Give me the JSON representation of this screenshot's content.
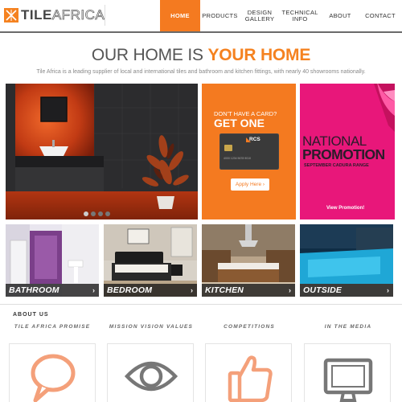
{
  "brand": {
    "name_bold": "TILE",
    "name_thin": "AFRICA",
    "accent": "#f58220"
  },
  "nav": [
    {
      "label": "HOME",
      "active": true
    },
    {
      "label": "PRODUCTS"
    },
    {
      "label": "DESIGN GALLERY"
    },
    {
      "label": "TECHNICAL INFO"
    },
    {
      "label": "ABOUT"
    },
    {
      "label": "CONTACT"
    }
  ],
  "hero": {
    "headline_a": "OUR HOME IS ",
    "headline_b": "YOUR HOME",
    "intro": "Tile Africa is a leading supplier of local and international tiles and bathroom and kitchen fittings, with nearly 40 showrooms nationally."
  },
  "slider": {
    "slides": 4,
    "active": 1
  },
  "promo_card": {
    "question": "DON'T HAVE A CARD?",
    "cta_title": "GET ONE",
    "card_brand": "RCS",
    "card_number": "4000 1234 5678 9010",
    "button": "Apply Here"
  },
  "promo_national": {
    "line1": "NATIONAL",
    "line2": "PROMOTION",
    "line3": "SEPTEMBER CADURA RANGE",
    "link": "View Promotion!",
    "color": "#e8177a"
  },
  "categories": [
    {
      "label": "BATHROOM"
    },
    {
      "label": "BEDROOM"
    },
    {
      "label": "KITCHEN"
    },
    {
      "label": "OUTSIDE"
    }
  ],
  "about": {
    "title": "ABOUT US",
    "items": [
      {
        "title": "TILE AFRICA PROMISE",
        "icon": "speech-bubble-icon"
      },
      {
        "title": "MISSION VISION VALUES",
        "icon": "eye-icon"
      },
      {
        "title": "COMPETITIONS",
        "icon": "thumbs-up-icon"
      },
      {
        "title": "IN THE MEDIA",
        "icon": "monitor-icon"
      }
    ]
  }
}
